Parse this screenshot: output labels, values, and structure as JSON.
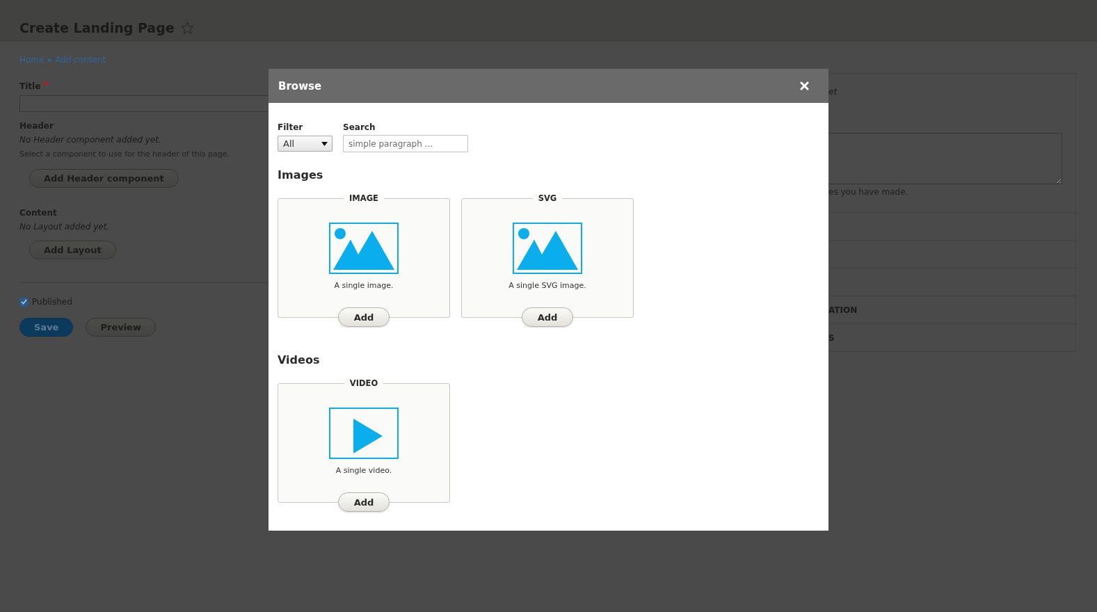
{
  "page": {
    "title": "Create Landing Page",
    "breadcrumb": {
      "links": [
        "Home",
        "Add content"
      ],
      "separator": "»"
    }
  },
  "form": {
    "title_field": {
      "label": "Title",
      "required_mark": "*"
    },
    "header": {
      "label": "Header",
      "empty_text": "No Header component added yet.",
      "description": "Select a component to use for the header of this page.",
      "button": "Add Header component"
    },
    "content": {
      "label": "Content",
      "empty_text": "No Layout added yet.",
      "button": "Add Layout"
    },
    "published": {
      "label": "Published",
      "checked": true
    },
    "actions": [
      {
        "label": "Save",
        "kind": "primary"
      },
      {
        "label": "Preview",
        "kind": "secondary"
      }
    ]
  },
  "sidebar": {
    "note": "et",
    "help_text": "es you have made.",
    "sections": [
      {
        "label": "ATION"
      },
      {
        "label": "S"
      }
    ]
  },
  "dialog": {
    "title": "Browse",
    "filter": {
      "label": "Filter",
      "value": "All"
    },
    "search": {
      "label": "Search",
      "placeholder": "simple paragraph ..."
    },
    "groups": [
      {
        "heading": "Images",
        "items": [
          {
            "label": "IMAGE",
            "kind": "image",
            "description": "A single image.",
            "button": "Add"
          },
          {
            "label": "SVG",
            "kind": "image",
            "description": "A single SVG image.",
            "button": "Add"
          }
        ]
      },
      {
        "heading": "Videos",
        "items": [
          {
            "label": "VIDEO",
            "kind": "video",
            "description": "A single video.",
            "button": "Add"
          }
        ]
      }
    ]
  }
}
